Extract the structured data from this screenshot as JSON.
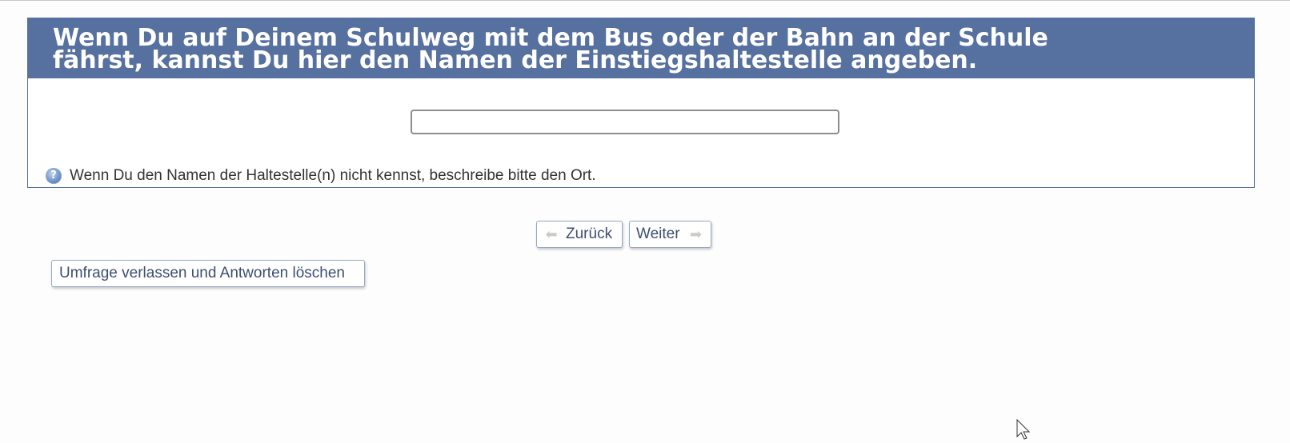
{
  "question": {
    "title": "Wenn Du auf Deinem Schulweg mit dem Bus oder der Bahn an der Schule fährst, kannst Du hier den Namen der Einstiegshaltestelle angeben.",
    "title_line1": "Wenn Du auf Deinem Schulweg mit dem Bus oder der Bahn an der Schule",
    "title_line2": "fährst, kannst Du hier den Namen der Einstiegshaltestelle angeben.",
    "answer_value": "",
    "help_text": "Wenn Du den Namen der Haltestelle(n) nicht kennst, beschreibe bitte den Ort.",
    "help_icon": "question-help-icon"
  },
  "navigation": {
    "prev_label": "Zurück",
    "next_label": "Weiter",
    "exit_label": "Umfrage verlassen und Antworten löschen",
    "prev_icon": "arrow-left-icon",
    "next_icon": "arrow-right-icon"
  },
  "colors": {
    "header_bg": "#56709f",
    "header_text": "#ffffff",
    "button_text": "#3d4e73",
    "button_border": "#97a8c7"
  }
}
